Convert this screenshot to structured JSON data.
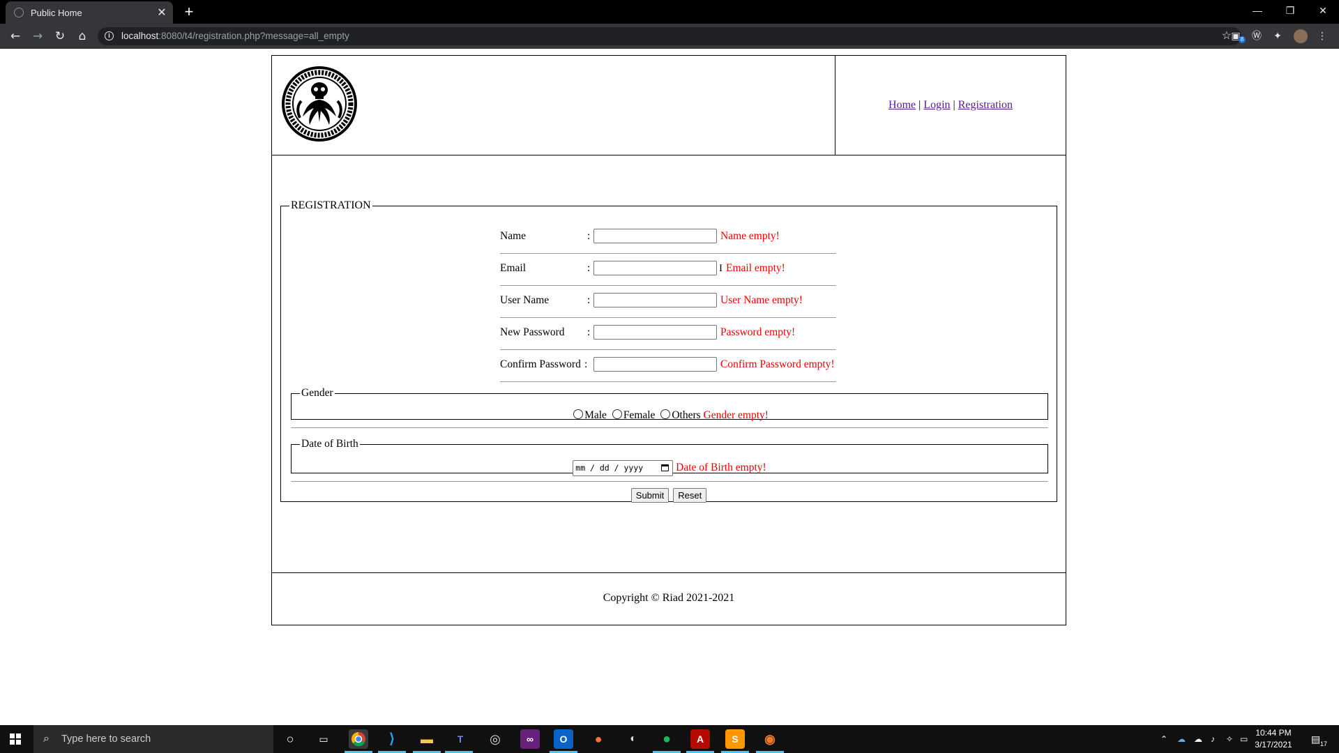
{
  "browser": {
    "tab_title": "Public Home",
    "tab_close": "✕",
    "new_tab": "+",
    "url_host": "localhost",
    "url_rest": ":8080/t4/registration.php?message=all_empty",
    "ext_badge_count": "8"
  },
  "header": {
    "nav": [
      {
        "label": "Home"
      },
      {
        "label": "Login"
      },
      {
        "label": "Registration"
      }
    ],
    "separator": "|"
  },
  "form": {
    "legend": "REGISTRATION",
    "fields": [
      {
        "label": "Name",
        "colon": ":",
        "value": "",
        "error": "Name empty!"
      },
      {
        "label": "Email",
        "colon": ":",
        "value": "",
        "error": "Email empty!"
      },
      {
        "label": "User Name",
        "colon": ":",
        "value": "",
        "error": "User Name empty!"
      },
      {
        "label": "New Password",
        "colon": ":",
        "value": "",
        "error": "Password empty!"
      },
      {
        "label": "Confirm Password",
        "colon": ":",
        "value": "",
        "error": "Confirm Password empty!"
      }
    ],
    "gender": {
      "legend": "Gender",
      "options": [
        "Male",
        "Female",
        "Others"
      ],
      "error": "Gender empty!"
    },
    "dob": {
      "legend": "Date of Birth",
      "placeholder": "mm / dd / yyyy",
      "error": "Date of Birth empty!"
    },
    "submit_label": "Submit",
    "reset_label": "Reset"
  },
  "footer": {
    "copyright": "Copyright © Riad 2021-2021"
  },
  "taskbar": {
    "search_placeholder": "Type here to search",
    "time": "10:44 PM",
    "date": "3/17/2021",
    "notification_count": "17"
  }
}
